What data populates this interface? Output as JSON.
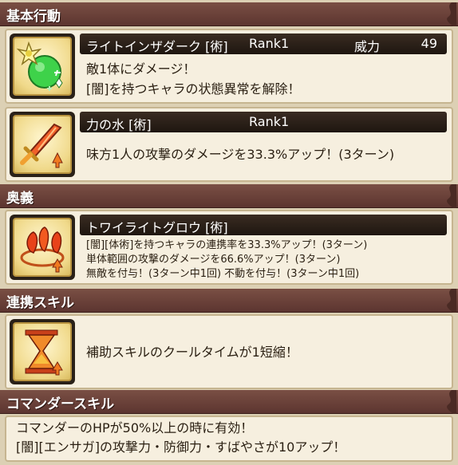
{
  "sections": {
    "basic": "基本行動",
    "ougi": "奥義",
    "combo": "連携スキル",
    "commander": "コマンダースキル"
  },
  "skills": {
    "light": {
      "name": "ライトインザダーク [術]",
      "rank": "Rank1",
      "power_label": "威力",
      "power_value": "49",
      "desc": [
        "敵1体にダメージ！",
        "[闇]を持つキャラの状態異常を解除！"
      ]
    },
    "water": {
      "name": "力の水 [術]",
      "rank": "Rank1",
      "desc": [
        "味方1人の攻撃のダメージを33.3%アップ！(3ターン)"
      ]
    },
    "twilight": {
      "name": "トワイライトグロウ [術]",
      "desc": [
        "[闇][体術]を持つキャラの連携率を33.3%アップ！(3ターン)",
        "単体範囲の攻撃のダメージを66.6%アップ！(3ターン)",
        "無敵を付与！(3ターン中1回) 不動を付与！(3ターン中1回)"
      ]
    },
    "combo": {
      "desc": [
        "補助スキルのクールタイムが1短縮！"
      ]
    },
    "commander": {
      "desc": [
        "コマンダーのHPが50%以上の時に有効！",
        "[闇][エンサガ]の攻撃力・防御力・すばやさが10アップ！"
      ]
    }
  },
  "icons": {
    "light": "green-orb-sparkle-icon",
    "water": "sword-up-arrow-icon",
    "twilight": "triple-flame-icon",
    "combo": "hourglass-up-arrow-icon"
  },
  "colors": {
    "header": "#6b4038",
    "card_bg": "#f6efdf",
    "name_bar": "#2a1f18"
  }
}
